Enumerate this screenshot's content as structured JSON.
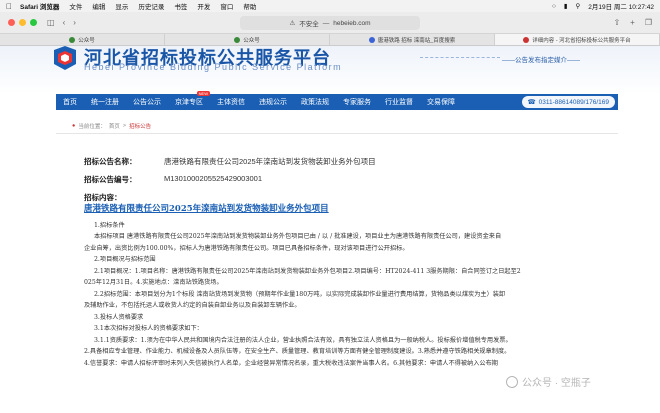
{
  "menubar": {
    "app": "Safari 浏览器",
    "items": [
      "文件",
      "编辑",
      "显示",
      "历史记录",
      "书签",
      "开发",
      "窗口",
      "帮助"
    ],
    "datetime": "2月19日 周二 10:27:42"
  },
  "toolbar": {
    "security": "不安全",
    "url": "hebeieb.com"
  },
  "tabs": [
    {
      "label": "公众号"
    },
    {
      "label": "公众号"
    },
    {
      "label": "唐港铁路 招标 滦南站_百度搜索"
    },
    {
      "label": "详细内容 - 河北省招标投标公共服务平台"
    }
  ],
  "site": {
    "title": "河北省招标投标公共服务平台",
    "subtitle": "Hebei Province Bidding Public Service Platform",
    "announce": "——公告发布指定媒介——"
  },
  "nav": {
    "items": [
      "首页",
      "统一注册",
      "公告公示",
      "京津专区",
      "主体资信",
      "违规公示",
      "政策法规",
      "专家服务",
      "行业监督",
      "交易保障"
    ],
    "new_badge": "NEW",
    "phone": "0311-88614089/176/169"
  },
  "breadcrumb": {
    "label": "当前位置：",
    "home": "首页",
    "sep": ">",
    "current": "招标公告"
  },
  "info": {
    "name_label": "招标公告名称：",
    "name_value": "唐港铁路有限责任公司2025年滦南站到发货物装卸业务外包项目",
    "code_label": "招标公告编号：",
    "code_value": "M1301000205525429003001",
    "content_label": "招标内容："
  },
  "document": {
    "title": "唐港铁路有限责任公司2025年滦南站到发货物装卸业务外包项目",
    "lines": [
      {
        "t": "1.招标条件",
        "ind": true
      },
      {
        "t": "本招标项目 唐港铁路有限责任公司2025年滦南站到发货物装卸业务外包项目已由 / 以 / 批准建设，项目业主为唐港铁路有限责任公司，建设资金来自",
        "ind": true
      },
      {
        "t": "企业自筹，出资比例为100.00%，招标人为唐港铁路有限责任公司。项目已具备招标条件，现对该项目进行公开招标。",
        "ind": false
      },
      {
        "t": "2.项目概况与招标范围",
        "ind": true
      },
      {
        "t": "2.1项目概况：1.项目名称：唐港铁路有限责任公司2025年滦南站到发货物装卸业务外包项目2.项目编号：HT2024-411 3服务期限：自合同签订之日起至2",
        "ind": true
      },
      {
        "t": "025年12月31日。4.实施地点：滦南站铁路货场。",
        "ind": false
      },
      {
        "t": "2.2招标范围：本项目划分为1个标段 滦南站货场到发货物（预期年作业量180万吨，以实际完成装卸作业量进行费用结算，货物品类以煤炭为主）装卸",
        "ind": true
      },
      {
        "t": "及辅助作业，不包括托运人或收货人约定的自装自卸业务以及自装卸车辆作业。",
        "ind": false
      },
      {
        "t": "3.投标人资格要求",
        "ind": true
      },
      {
        "t": "3.1本次招标对投标人的资格要求如下：",
        "ind": true
      },
      {
        "t": "3.1.1资质要求：1.须为在中华人民共和国境内合法注册的法人企业，营业执照合法有效，具有独立法人资格且为一般纳税人。投标报价增值税专用发票。",
        "ind": true
      },
      {
        "t": "2.具备相应专业管理、作业能力、机械设备及人员队伍等，在安全生产、质量管理、教育培训等方面有健全管理制度建设。3.熟悉并遵守铁路相关规章制度。",
        "ind": false
      },
      {
        "t": "4.信誉要求：申请人招标评审时未列入失信被执行人名单，企业经营异常情况名录，重大税收违法案件当事人名。6.其他要求：申请人不得被纳入公布期",
        "ind": false
      }
    ]
  },
  "watermark": "公众号 · 空瓶子",
  "colors": {
    "nav_bg": "#1a5fb4",
    "title_blue": "#1a56a8",
    "breadcrumb_current": "#cc3333"
  }
}
